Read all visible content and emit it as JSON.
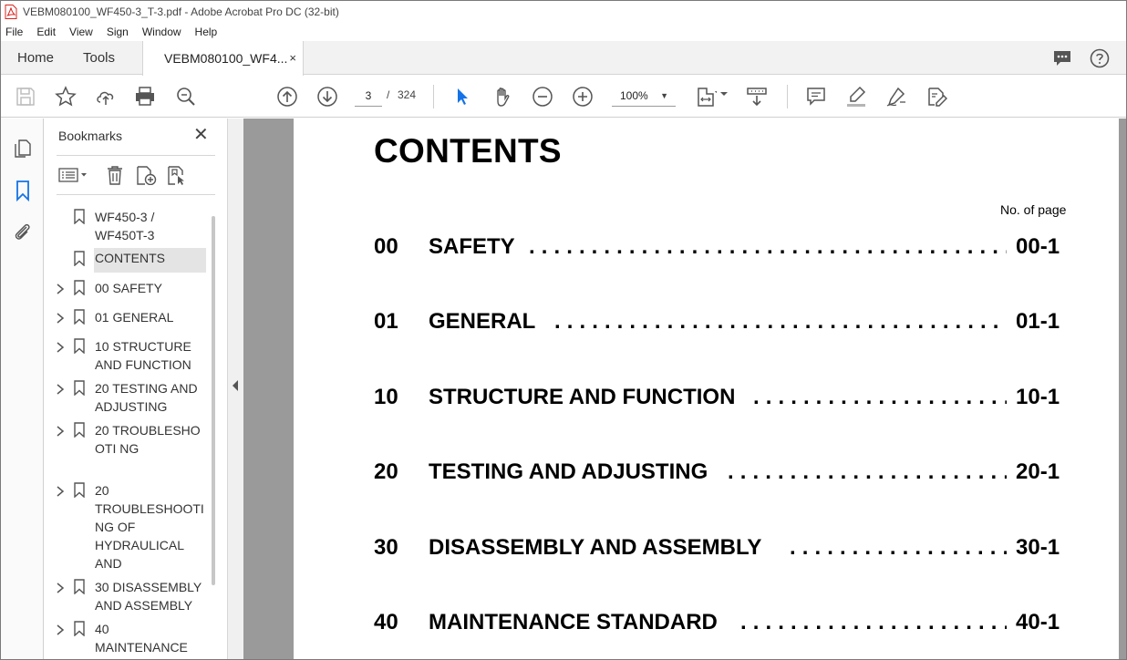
{
  "window": {
    "title": "VEBM080100_WF450-3_T-3.pdf - Adobe Acrobat Pro DC (32-bit)"
  },
  "menu": [
    "File",
    "Edit",
    "View",
    "Sign",
    "Window",
    "Help"
  ],
  "tabs": {
    "home": "Home",
    "tools": "Tools",
    "document": "VEBM080100_WF4...",
    "close_glyph": "×"
  },
  "toolbar": {
    "current_page": "3",
    "separator": "/",
    "total_pages": "324",
    "zoom": "100%",
    "zoom_caret": "▼"
  },
  "bookmarks": {
    "header": "Bookmarks",
    "close_glyph": "✕",
    "items": [
      {
        "label": "WF450-3 / WF450T-3",
        "expandable": false,
        "selected": false
      },
      {
        "label": "CONTENTS",
        "expandable": false,
        "selected": true
      },
      {
        "label": "00 SAFETY",
        "expandable": true,
        "selected": false
      },
      {
        "label": "01 GENERAL",
        "expandable": true,
        "selected": false
      },
      {
        "label": "10 STRUCTURE AND FUNCTION",
        "expandable": true,
        "selected": false
      },
      {
        "label": "20 TESTING AND ADJUSTING",
        "expandable": true,
        "selected": false
      },
      {
        "label": "20 TROUBLESHOOTI NG",
        "expandable": true,
        "selected": false
      },
      {
        "label": "20 TROUBLESHOOTI NG OF HYDRAULICAL AND",
        "expandable": true,
        "selected": false
      },
      {
        "label": "30 DISASSEMBLY AND ASSEMBLY",
        "expandable": true,
        "selected": false
      },
      {
        "label": "40 MAINTENANCE",
        "expandable": true,
        "selected": false
      }
    ]
  },
  "document": {
    "title": "CONTENTS",
    "page_column_label": "No. of page",
    "toc": [
      {
        "num": "00",
        "title": "SAFETY",
        "page": "00-1"
      },
      {
        "num": "01",
        "title": "GENERAL",
        "page": "01-1"
      },
      {
        "num": "10",
        "title": "STRUCTURE AND FUNCTION",
        "page": "10-1"
      },
      {
        "num": "20",
        "title": "TESTING AND ADJUSTING",
        "page": "20-1"
      },
      {
        "num": "30",
        "title": "DISASSEMBLY AND ASSEMBLY",
        "page": "30-1"
      },
      {
        "num": "40",
        "title": "MAINTENANCE STANDARD",
        "page": "40-1"
      }
    ]
  },
  "colors": {
    "accent_blue": "#1473e6",
    "selection_gray": "#e4e4e4",
    "canvas_gray": "#9a9a9a"
  },
  "icons": {
    "title_app": "acrobat-pdf-icon",
    "comments": "comment-bubble-icon",
    "help": "help-circle-icon",
    "save": "save-icon",
    "bookmark_star": "star-icon",
    "upload": "upload-cloud-icon",
    "print": "printer-icon",
    "find": "zoom-search-icon",
    "prev_page": "arrow-up-circle-icon",
    "next_page": "arrow-down-circle-icon",
    "select": "cursor-arrow-icon",
    "hand": "hand-icon",
    "zoom_out": "minus-circle-icon",
    "zoom_in": "plus-circle-icon",
    "fit_page": "fit-page-icon",
    "scroll_mode": "scroll-mode-icon",
    "comment": "comment-icon",
    "highlight": "highlighter-icon",
    "sign": "pen-sign-icon",
    "edit_pdf": "edit-pdf-icon"
  }
}
